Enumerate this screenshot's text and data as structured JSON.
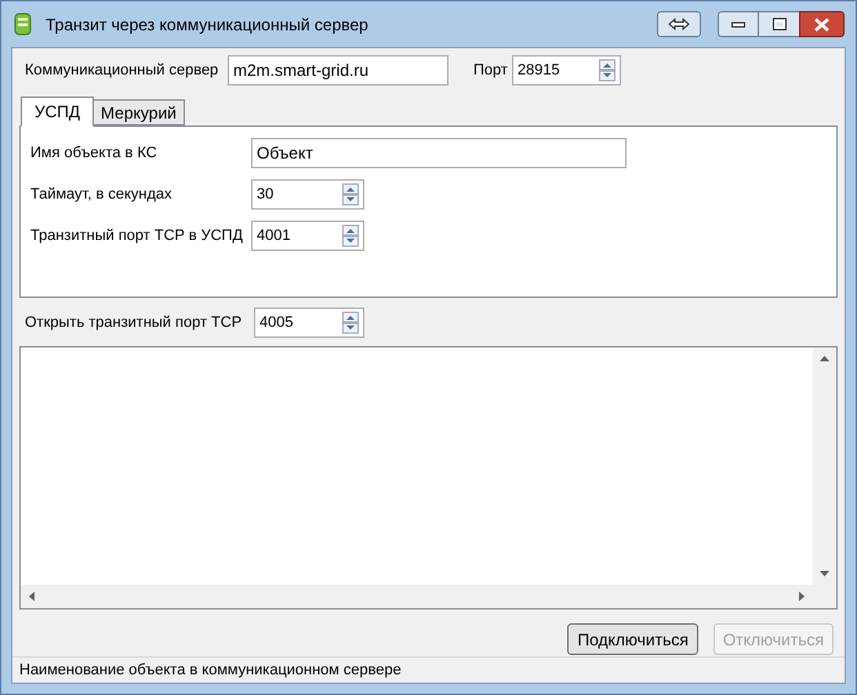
{
  "window": {
    "title": "Транзит через коммуникационный сервер"
  },
  "server": {
    "label": "Коммуникационный сервер",
    "value": "m2m.smart-grid.ru",
    "port_label": "Порт",
    "port": "28915"
  },
  "tabs": [
    {
      "label": "УСПД",
      "selected": true
    },
    {
      "label": "Меркурий",
      "selected": false
    }
  ],
  "fields": [
    {
      "kind": "text",
      "label": "Имя объекта в КС",
      "value": "Объект"
    },
    {
      "kind": "spin",
      "label": "Таймаут, в секундах",
      "value": "30"
    },
    {
      "kind": "spin",
      "label": "Транзитный порт TCP в УСПД",
      "value": "4001"
    }
  ],
  "open_port": {
    "label": "Открыть транзитный порт TCP",
    "value": "4005"
  },
  "buttons": [
    {
      "label": "Подключиться",
      "disabled": false
    },
    {
      "label": "Отключиться",
      "disabled": true
    }
  ],
  "status_bar": "Наименование объекта в коммуникационном сервере"
}
